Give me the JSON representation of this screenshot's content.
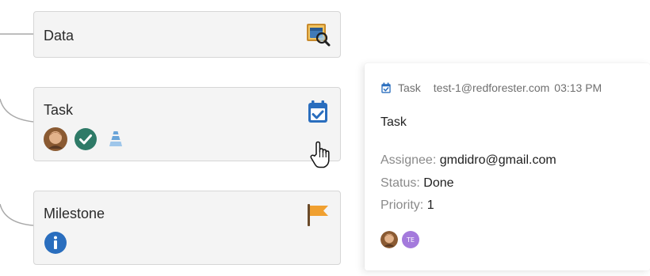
{
  "nodes": {
    "data": {
      "title": "Data",
      "icon": "data-search-icon"
    },
    "task": {
      "title": "Task",
      "icon": "calendar-check-icon",
      "badges": [
        "user-avatar-icon",
        "status-done-check-icon",
        "priority-pyramid-icon"
      ]
    },
    "milestone": {
      "title": "Milestone",
      "icon": "flag-icon",
      "badges": [
        "info-icon"
      ]
    }
  },
  "popup": {
    "type_label": "Task",
    "author": "test-1@redforester.com",
    "time": "03:13 PM",
    "title": "Task",
    "assignee_label": "Assignee:",
    "assignee_value": "gmdidro@gmail.com",
    "status_label": "Status:",
    "status_value": "Done",
    "priority_label": "Priority:",
    "priority_value": "1",
    "avatar_initials": "TE"
  },
  "colors": {
    "node_bg": "#f4f4f4",
    "node_border": "#d6d6d6",
    "calendar_blue": "#2a6ebe",
    "check_green": "#2e7a67",
    "info_blue": "#2a6ebe",
    "flag_orange": "#f0a030",
    "initials_purple": "#a47adc"
  }
}
